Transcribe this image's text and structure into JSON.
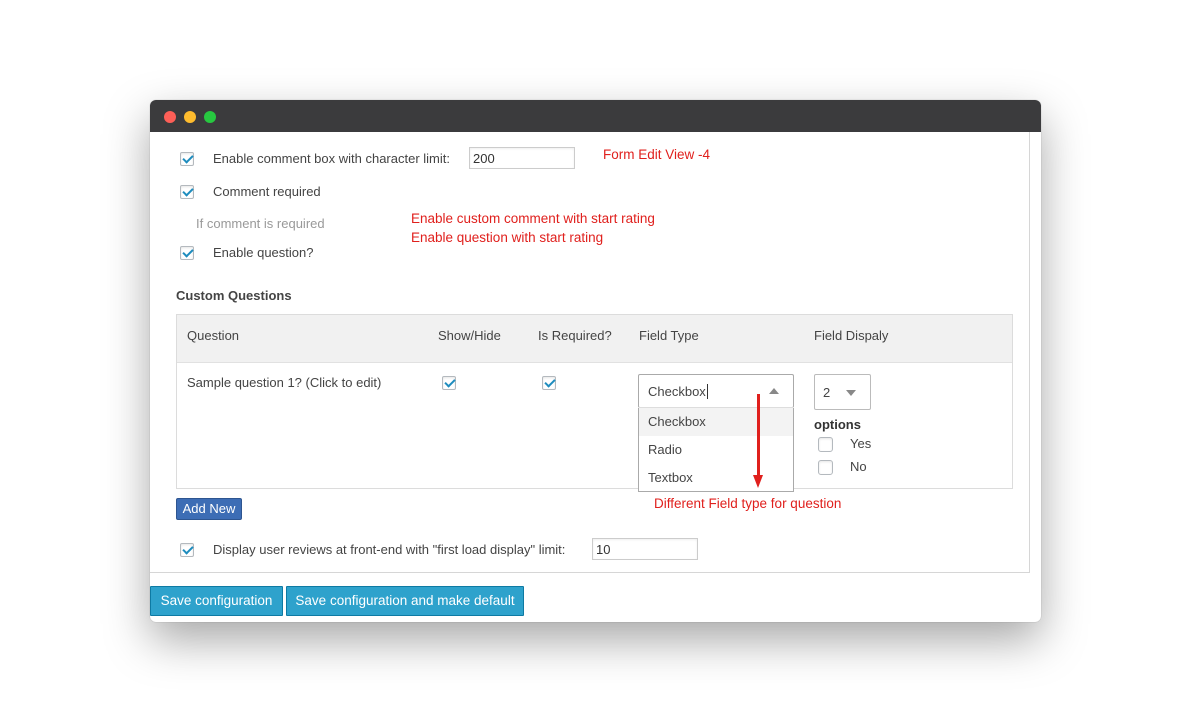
{
  "settings": {
    "enable_comment_label": "Enable comment box with character limit:",
    "comment_limit_value": "200",
    "comment_required_label": "Comment required",
    "if_comment_required_label": "If comment is required",
    "enable_question_label": "Enable question?",
    "custom_questions_heading": "Custom Questions",
    "display_reviews_label": "Display user reviews at front-end with \"first load display\" limit:",
    "display_limit_value": "10"
  },
  "annotations": {
    "form_edit_view": "Form Edit View -4",
    "custom_comment": "Enable custom comment with start rating",
    "question_rating": "Enable question with start rating",
    "field_type_note": "Different Field type for question"
  },
  "table": {
    "headers": [
      "Question",
      "Show/Hide",
      "Is Required?",
      "Field Type",
      "Field Dispaly"
    ],
    "row": {
      "question": "Sample question 1? (Click to edit)",
      "field_type_value": "Checkbox",
      "field_type_options": [
        "Checkbox",
        "Radio",
        "Textbox"
      ],
      "field_display_value": "2",
      "options_label": "options",
      "option_items": [
        "Yes",
        "No"
      ]
    }
  },
  "buttons": {
    "add_new": "Add New",
    "save_config": "Save configuration",
    "save_default": "Save configuration and make default"
  },
  "colors": {
    "annotation": "#e0201d",
    "save_button": "#2ea2cc",
    "add_new_button": "#3d6db5"
  }
}
